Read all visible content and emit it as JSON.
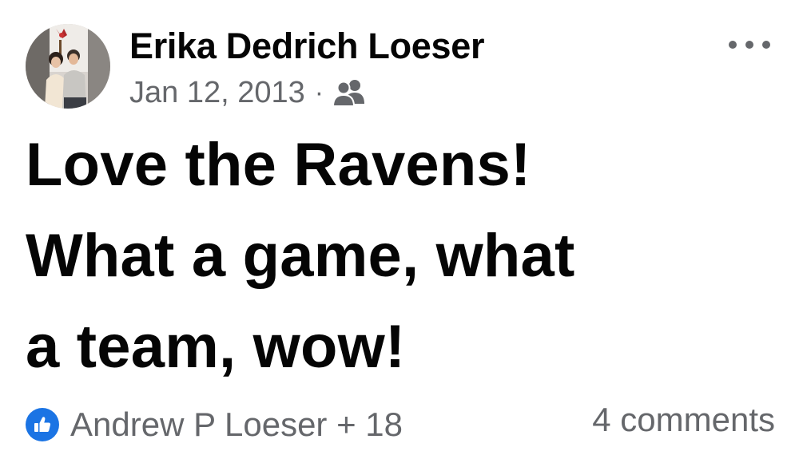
{
  "post": {
    "author": "Erika Dedrich Loeser",
    "date": "Jan 12, 2013",
    "separator": "·",
    "audience_icon": "friends-icon",
    "text_line_1": "Love the Ravens!",
    "text_line_2": "What a game, what",
    "text_line_3": "a team, wow!",
    "reaction_icon": "like-icon",
    "reactors": "Andrew P Loeser + 18",
    "comments": "4 comments",
    "more_icon": "more-options-icon"
  },
  "colors": {
    "text_primary": "#050505",
    "text_secondary": "#65676b",
    "like_blue": "#1b74e4",
    "background": "#ffffff"
  }
}
